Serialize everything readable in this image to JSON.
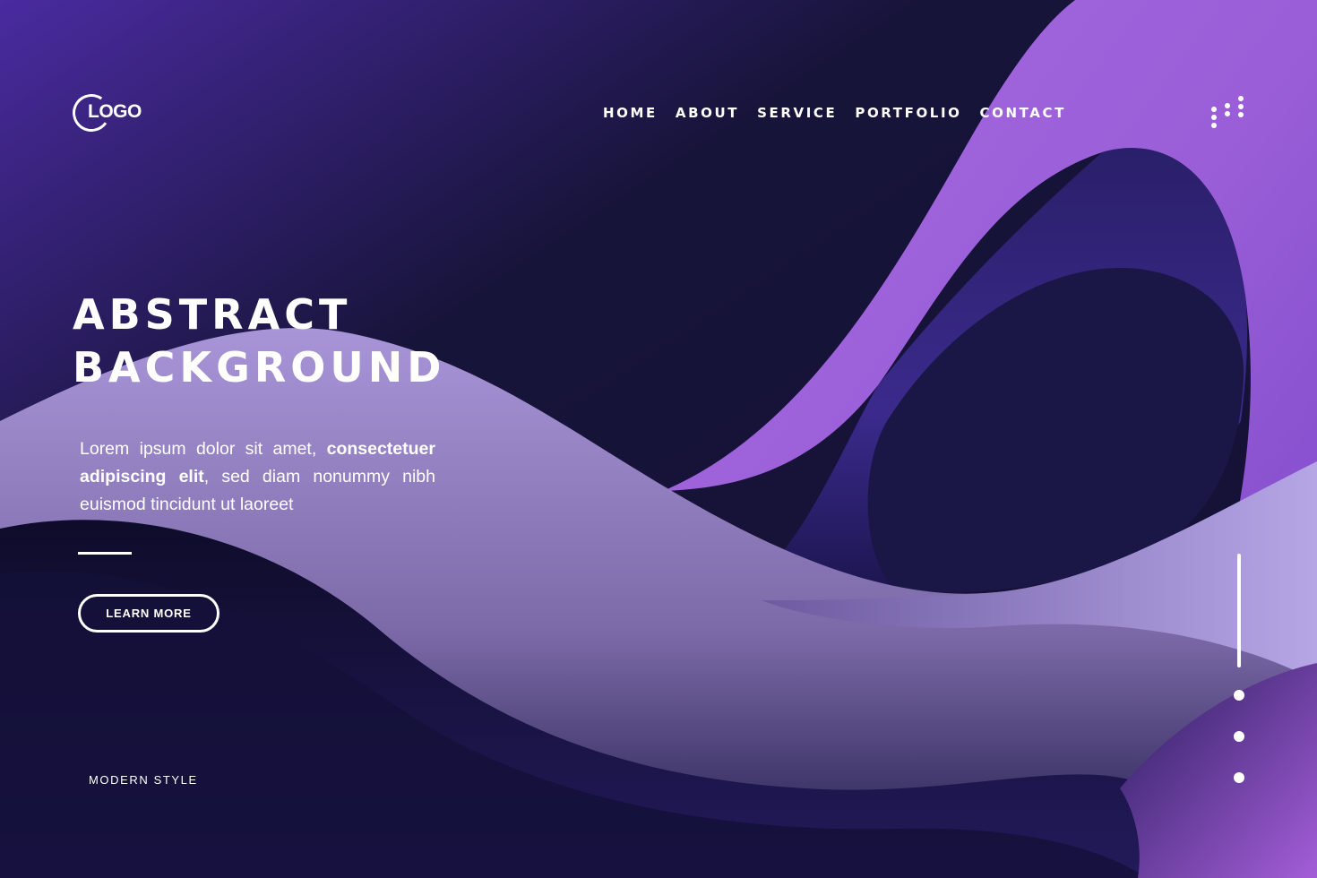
{
  "header": {
    "logo_text": "LOGO",
    "nav": [
      {
        "label": "HOME"
      },
      {
        "label": "ABOUT"
      },
      {
        "label": "SERVICE"
      },
      {
        "label": "PORTFOLIO"
      },
      {
        "label": "CONTACT"
      }
    ],
    "menu_icon": "dots-grid-icon"
  },
  "hero": {
    "title_lines": [
      "ABSTRACT",
      "BACKGROUND"
    ],
    "description_parts": [
      "Lorem ipsum dolor sit amet, ",
      "consectetuer adipiscing elit",
      ", sed diam nonummy nibh euismod tincidunt ut laoreet"
    ],
    "button_label": "LEARN MORE"
  },
  "footer": {
    "tagline": "MODERN STYLE"
  },
  "pager": {
    "slide_count": 4,
    "active_index": 0
  },
  "colors": {
    "background": "#15123a",
    "deep_purple": "#3b2a8c",
    "lavender": "#a68fd6",
    "violet": "#a15ee0",
    "text": "#ffffff"
  }
}
